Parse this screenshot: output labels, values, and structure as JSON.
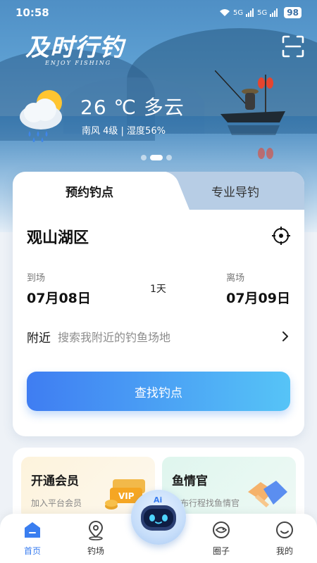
{
  "status": {
    "time": "10:58",
    "signal1": "5G",
    "signal2": "5G",
    "battery": "98"
  },
  "header": {
    "logo_text": "及时行钓",
    "logo_sub": "ENJOY FISHING"
  },
  "weather": {
    "temp": "26 ℃ 多云",
    "detail": "南风 4级 | 湿度56%"
  },
  "tabs": [
    {
      "label": "预约钓点",
      "active": true
    },
    {
      "label": "专业导钓",
      "active": false
    }
  ],
  "booking": {
    "location": "观山湖区",
    "arrive_label": "到场",
    "arrive_date": "07月08日",
    "nights": "1天",
    "leave_label": "离场",
    "leave_date": "07月09日",
    "nearby_label": "附近",
    "nearby_placeholder": "搜索我附近的钓鱼场地",
    "find_button": "查找钓点"
  },
  "promos": [
    {
      "title": "开通会员",
      "subtitle": "加入平台会员",
      "badge": "VIP"
    },
    {
      "title": "鱼情官",
      "subtitle": "发布行程找鱼情官"
    }
  ],
  "nav": [
    {
      "label": "首页",
      "active": true
    },
    {
      "label": "钓场",
      "active": false
    },
    {
      "label": "圈子",
      "active": false
    },
    {
      "label": "我的",
      "active": false
    }
  ],
  "robot": {
    "label": "Ai"
  },
  "colors": {
    "accent": "#3a7ef0",
    "button_start": "#3f7df2",
    "button_end": "#56c4f7"
  }
}
